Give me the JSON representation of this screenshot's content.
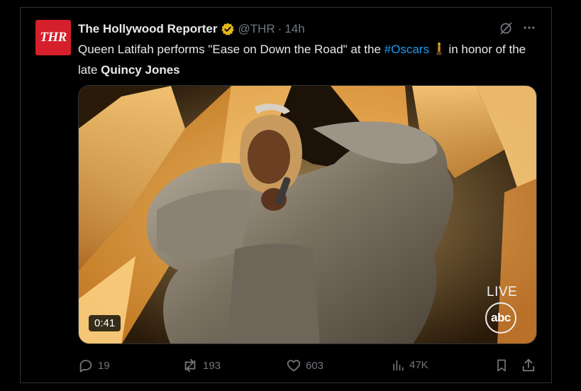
{
  "tweet": {
    "avatar_text": "THR",
    "author_name": "The Hollywood Reporter",
    "handle": "@THR",
    "separator": "·",
    "time": "14h",
    "text": {
      "part1": "Queen Latifah performs \"Ease on Down the Road\" at the ",
      "hashtag": "#Oscars",
      "part2": " in honor of the late ",
      "mention": "Quincy Jones"
    },
    "media": {
      "duration": "0:41",
      "live_label": "LIVE",
      "network_logo": "abc"
    },
    "actions": {
      "replies": "19",
      "reposts": "193",
      "likes": "603",
      "views": "47K"
    }
  },
  "colors": {
    "background": "#000000",
    "text": "#e7e9ea",
    "muted": "#71767b",
    "link": "#1d9bf0",
    "verified": "#e2b719",
    "avatar": "#d51f2a"
  },
  "icons": [
    "verified-badge-icon",
    "grok-icon",
    "more-icon",
    "oscar-statue-emoji",
    "reply-icon",
    "repost-icon",
    "like-icon",
    "views-icon",
    "bookmark-icon",
    "share-icon"
  ]
}
